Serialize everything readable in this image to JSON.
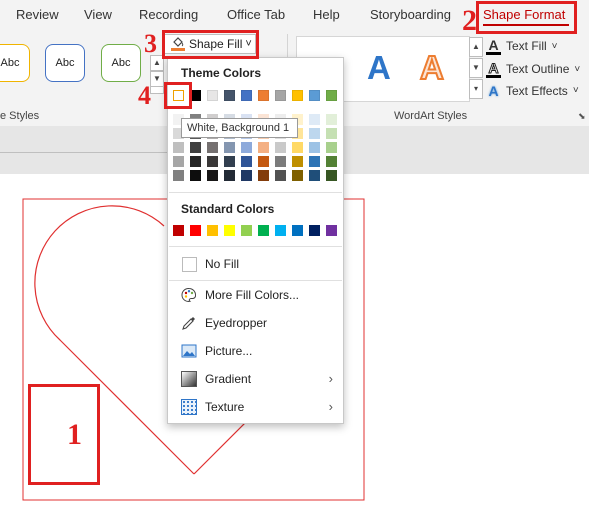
{
  "tabs": [
    "Review",
    "View",
    "Recording",
    "Office Tab",
    "Help",
    "Storyboarding",
    "Shape Format"
  ],
  "ribbon": {
    "shape_style_sample": "Abc",
    "shape_fill_label": "Shape Fill",
    "shape_fill_caret": "˅",
    "shape_styles_group": "e Styles",
    "wordart_group": "WordArt Styles",
    "wordart_letter": "A",
    "text_fill": "Text Fill",
    "text_outline": "Text Outline",
    "text_effects": "Text Effects"
  },
  "menu": {
    "theme_colors_heading": "Theme Colors",
    "standard_colors_heading": "Standard Colors",
    "no_fill": "No Fill",
    "more_fill_colors": "More Fill Colors...",
    "eyedropper": "Eyedropper",
    "picture": "Picture...",
    "gradient": "Gradient",
    "texture": "Texture",
    "submenu_arrow": "›"
  },
  "tooltip": "White, Background 1",
  "theme_colors_top": [
    "#ffffff",
    "#000000",
    "#e7e6e6",
    "#44546a",
    "#4472c4",
    "#ed7d31",
    "#a5a5a5",
    "#ffc000",
    "#5b9bd5",
    "#70ad47"
  ],
  "theme_shades": [
    [
      "#f2f2f2",
      "#808080",
      "#d0cece",
      "#d6dce4",
      "#d9e2f3",
      "#fbe4d5",
      "#ededed",
      "#fff2cc",
      "#deeaf6",
      "#e2efd9"
    ],
    [
      "#d9d9d9",
      "#595959",
      "#aeabab",
      "#adb9ca",
      "#b4c6e7",
      "#f7caac",
      "#dbdbdb",
      "#ffe599",
      "#bdd7ee",
      "#c5e0b3"
    ],
    [
      "#bfbfbf",
      "#404040",
      "#757070",
      "#8496b0",
      "#8eaadb",
      "#f4b083",
      "#c9c9c9",
      "#ffd966",
      "#9cc2e5",
      "#a8d08d"
    ],
    [
      "#a6a6a6",
      "#262626",
      "#3a3838",
      "#323f4f",
      "#2f5496",
      "#c45911",
      "#7b7b7b",
      "#bf8f00",
      "#2e74b5",
      "#538135"
    ],
    [
      "#808080",
      "#0d0d0d",
      "#171616",
      "#222a35",
      "#1f3864",
      "#833c0b",
      "#525252",
      "#7f6000",
      "#1f4e79",
      "#375623"
    ]
  ],
  "standard_colors": [
    "#c00000",
    "#ff0000",
    "#ffc000",
    "#ffff00",
    "#92d050",
    "#00b050",
    "#00b0f0",
    "#0070c0",
    "#002060",
    "#7030a0"
  ],
  "annotations": [
    "1",
    "2",
    "3",
    "4"
  ],
  "colors": {
    "accent": "#c00000",
    "annotation_red": "#e02020",
    "shape_outline": "#e03030"
  }
}
